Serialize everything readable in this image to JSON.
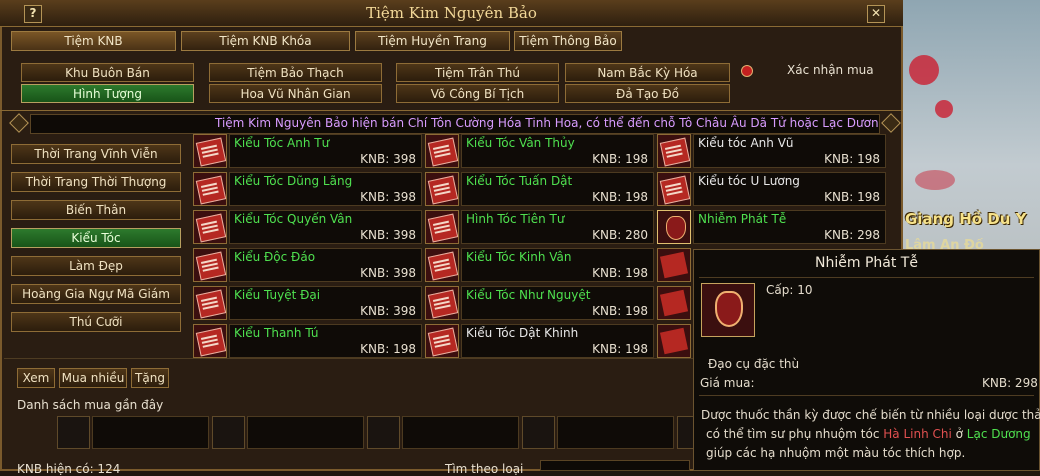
{
  "window": {
    "title": "Tiệm Kim Nguyên Bảo",
    "help_glyph": "?",
    "close_glyph": "✕"
  },
  "tabs": [
    {
      "label": "Tiệm KNB"
    },
    {
      "label": "Tiệm KNB Khóa"
    },
    {
      "label": "Tiệm Huyền Trang"
    },
    {
      "label": "Tiệm Thông Bảo"
    }
  ],
  "shops": [
    {
      "label": "Khu Buôn Bán"
    },
    {
      "label": "Tiệm Bảo Thạch"
    },
    {
      "label": "Tiệm Trân Thú"
    },
    {
      "label": "Nam Bắc Kỳ Hóa"
    },
    {
      "label": "Hình Tượng"
    },
    {
      "label": "Hoa Vũ Nhân Gian"
    },
    {
      "label": "Võ Công Bí Tịch"
    },
    {
      "label": "Đả Tạo Đồ"
    }
  ],
  "confirm_label": "Xác nhận mua",
  "marquee": "Tiệm Kim Nguyên Bảo hiện bán Chí Tôn Cường Hóa Tinh Hoa, có thể đến chỗ Tô Châu Âu Dã Tử hoặc Lạc Dương Phon",
  "categories": [
    {
      "label": "Thời Trang Vĩnh Viễn"
    },
    {
      "label": "Thời Trang Thời Thượng"
    },
    {
      "label": "Biến Thân"
    },
    {
      "label": "Kiểu Tóc"
    },
    {
      "label": "Làm Đẹp"
    },
    {
      "label": "Hoàng Gia Ngự Mã Giám"
    },
    {
      "label": "Thú Cưỡi"
    }
  ],
  "items": [
    {
      "name": "Kiểu Tóc Anh Tư",
      "price": "KNB: 398"
    },
    {
      "name": "Kiểu Tóc Vân Thủy",
      "price": "KNB: 198"
    },
    {
      "name": "Kiểu tóc Anh Vũ",
      "price": "KNB: 198"
    },
    {
      "name": "Kiểu Tóc Dũng Lãng",
      "price": "KNB: 398"
    },
    {
      "name": "Kiểu Tóc Tuấn Dật",
      "price": "KNB: 198"
    },
    {
      "name": "Kiểu tóc U Lương",
      "price": "KNB: 198"
    },
    {
      "name": "Kiểu Tóc Quyến Vân",
      "price": "KNB: 398"
    },
    {
      "name": "Hình Tóc Tiên Tư",
      "price": "KNB: 280"
    },
    {
      "name": "Nhiễm Phát Tễ",
      "price": "KNB: 298"
    },
    {
      "name": "Kiểu Độc Đáo",
      "price": "KNB: 398"
    },
    {
      "name": "Kiểu Tóc Kinh Vân",
      "price": "KNB: 198"
    },
    {
      "name": "Kiểu Tuyệt Đại",
      "price": "KNB: 398"
    },
    {
      "name": "Kiểu Tóc Như Nguyệt",
      "price": "KNB: 198"
    },
    {
      "name": "Kiểu Thanh Tú",
      "price": "KNB: 198"
    },
    {
      "name": "Kiểu Tóc Dật Khinh",
      "price": "KNB: 198"
    }
  ],
  "bottom": {
    "view_label": "Xem",
    "buy_many_label": "Mua nhiều",
    "gift_label": "Tặng",
    "recent_label": "Danh sách mua gần đây",
    "balance_label": "KNB hiện có: 124",
    "search_label": "Tìm theo loại"
  },
  "tooltip": {
    "title": "Nhiễm Phát Tễ",
    "level": "Cấp: 10",
    "type": "Đạo cụ đặc thù",
    "price_label": "Giá mua:",
    "price_value": "KNB: 298",
    "desc_1": "Dược thuốc thần kỳ được chế biến từ nhiều loại dược thảo,",
    "desc_2a": "có thể tìm sư phụ nhuộm tóc ",
    "desc_2b": "Hà Linh Chi",
    "desc_2c": " ở ",
    "desc_2d": "Lạc Dương",
    "desc_3": "giúp các hạ nhuộm một màu tóc thích hợp."
  },
  "world": {
    "text": "Giang Hồ Du Y",
    "text2": "Lâm An Đồ"
  },
  "colors": {
    "accent_green": "#4fe04f",
    "highlight_red": "#e05050",
    "marquee": "#d89cff"
  }
}
